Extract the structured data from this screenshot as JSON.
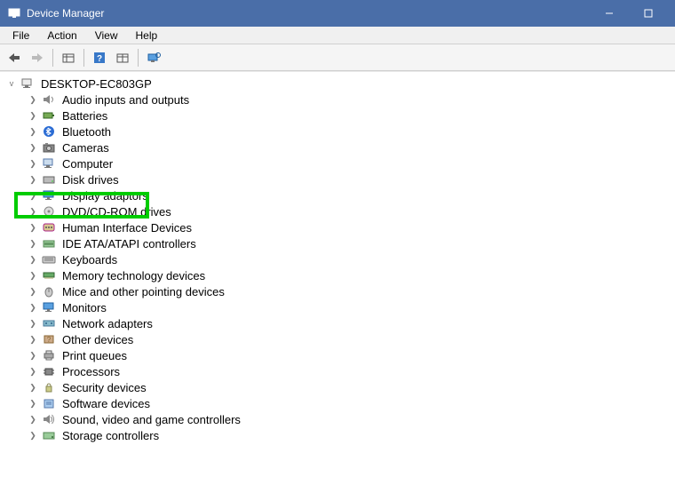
{
  "window": {
    "title": "Device Manager"
  },
  "menu": {
    "items": [
      "File",
      "Action",
      "View",
      "Help"
    ]
  },
  "tree": {
    "root": "DESKTOP-EC803GP",
    "categories": [
      {
        "label": "Audio inputs and outputs",
        "icon": "speaker"
      },
      {
        "label": "Batteries",
        "icon": "battery"
      },
      {
        "label": "Bluetooth",
        "icon": "bluetooth"
      },
      {
        "label": "Cameras",
        "icon": "camera"
      },
      {
        "label": "Computer",
        "icon": "computer"
      },
      {
        "label": "Disk drives",
        "icon": "disk"
      },
      {
        "label": "Display adaptors",
        "icon": "monitor",
        "highlighted": true
      },
      {
        "label": "DVD/CD-ROM drives",
        "icon": "cdrom"
      },
      {
        "label": "Human Interface Devices",
        "icon": "hid"
      },
      {
        "label": "IDE ATA/ATAPI controllers",
        "icon": "ide"
      },
      {
        "label": "Keyboards",
        "icon": "keyboard"
      },
      {
        "label": "Memory technology devices",
        "icon": "memory"
      },
      {
        "label": "Mice and other pointing devices",
        "icon": "mouse"
      },
      {
        "label": "Monitors",
        "icon": "monitor"
      },
      {
        "label": "Network adapters",
        "icon": "network"
      },
      {
        "label": "Other devices",
        "icon": "other"
      },
      {
        "label": "Print queues",
        "icon": "printer"
      },
      {
        "label": "Processors",
        "icon": "cpu"
      },
      {
        "label": "Security devices",
        "icon": "security"
      },
      {
        "label": "Software devices",
        "icon": "software"
      },
      {
        "label": "Sound, video and game controllers",
        "icon": "sound"
      },
      {
        "label": "Storage controllers",
        "icon": "storage"
      }
    ]
  }
}
